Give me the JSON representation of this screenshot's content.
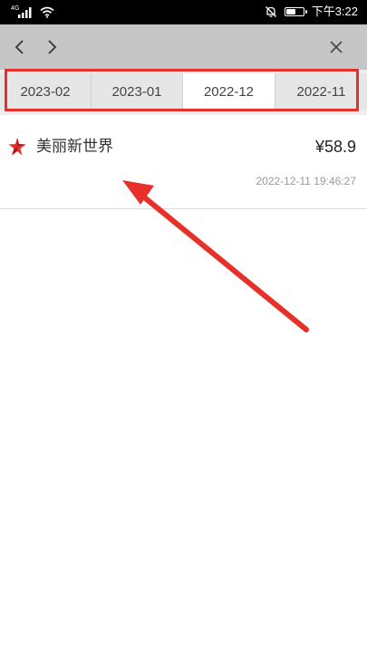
{
  "status_bar": {
    "signal_label": "4G",
    "time": "下午3:22",
    "battery_level": 0.6
  },
  "nav": {
    "back_icon": "chevron-left-icon",
    "forward_icon": "chevron-right-icon",
    "close_icon": "close-icon"
  },
  "tabs": [
    {
      "label": "2023-02"
    },
    {
      "label": "2023-01"
    },
    {
      "label": "2022-12",
      "selected": true
    },
    {
      "label": "2022-11"
    }
  ],
  "transactions": [
    {
      "merchant": "美丽新世界",
      "amount": "¥58.9",
      "time": "2022-12-11 19:46:27",
      "logo_icon": "star-logo-icon"
    }
  ],
  "colors": {
    "highlight": "#e8302a",
    "nav_bg": "#c6c6c6",
    "logo": "#e8302a"
  }
}
